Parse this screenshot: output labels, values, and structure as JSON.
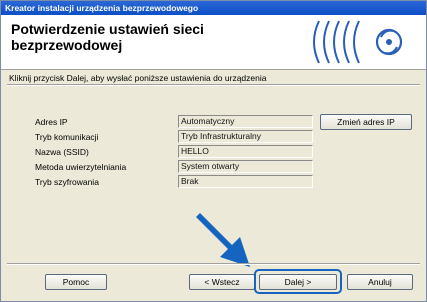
{
  "window": {
    "title": "Kreator instalacji urządzenia bezprzewodowego"
  },
  "header": {
    "title": "Potwierdzenie ustawień sieci bezprzewodowej"
  },
  "instruction": "Kliknij przycisk Dalej, aby wysłać poniższe ustawienia do urządzenia",
  "settings": [
    {
      "label": "Adres IP",
      "value": "Automatyczny"
    },
    {
      "label": "Tryb komunikacji",
      "value": "Tryb Infrastrukturalny"
    },
    {
      "label": "Nazwa (SSID)",
      "value": "HELLO"
    },
    {
      "label": "Metoda uwierzytelniania",
      "value": "System otwarty"
    },
    {
      "label": "Tryb szyfrowania",
      "value": "Brak"
    }
  ],
  "buttons": {
    "change_ip": "Zmień adres IP",
    "help": "Pomoc",
    "back": "< Wstecz",
    "next": "Dalej >",
    "cancel": "Anuluj"
  },
  "colors": {
    "titlebar": "#0d4fc6",
    "accent": "#1565c0",
    "logo": "#2a5fb8"
  },
  "icons": {
    "logo": "wireless-signal-icon",
    "pointer": "arrow-pointer-icon"
  }
}
